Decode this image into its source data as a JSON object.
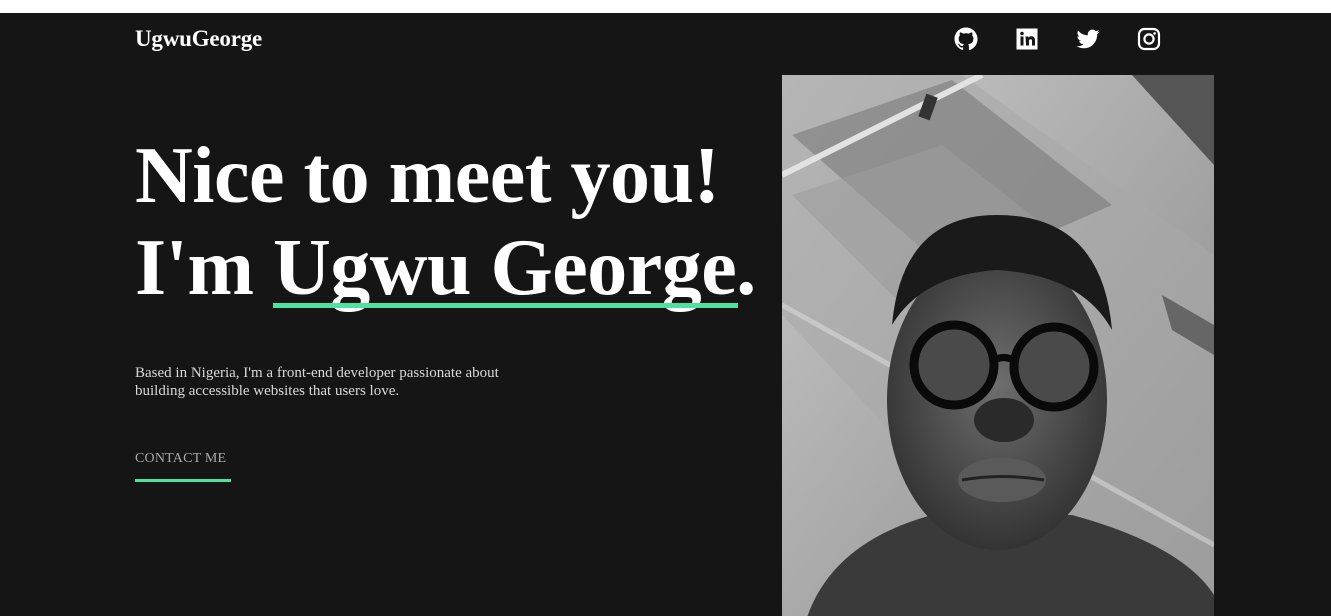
{
  "header": {
    "logo": "UgwuGeorge",
    "socials": [
      {
        "name": "github",
        "icon": "github-icon"
      },
      {
        "name": "linkedin",
        "icon": "linkedin-icon"
      },
      {
        "name": "twitter",
        "icon": "twitter-icon"
      },
      {
        "name": "instagram",
        "icon": "instagram-icon"
      }
    ]
  },
  "hero": {
    "line1": "Nice to meet you!",
    "line2_prefix": "I'm ",
    "name": "Ugwu George",
    "line2_suffix": ".",
    "intro": "Based in Nigeria, I'm a front-end developer passionate about building accessible websites that users love.",
    "cta": "CONTACT ME"
  },
  "colors": {
    "background": "#151515",
    "accent": "#4ee1a0",
    "text": "#ffffff",
    "muted": "#d9d9d9"
  }
}
